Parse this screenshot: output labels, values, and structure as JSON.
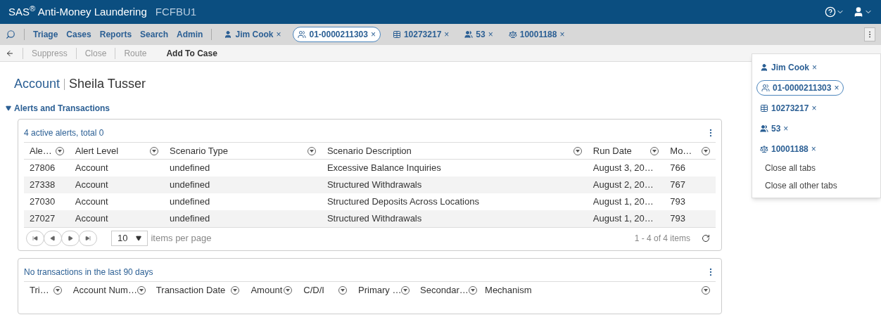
{
  "header": {
    "brand": "SAS",
    "brand_mark": "®",
    "product": "Anti-Money Laundering",
    "instance": "FCFBU1"
  },
  "nav": {
    "items": [
      "Triage",
      "Cases",
      "Reports",
      "Search",
      "Admin"
    ]
  },
  "tabs": [
    {
      "kind": "person",
      "label": "Jim Cook",
      "close": "×",
      "selected": false
    },
    {
      "kind": "case",
      "label": "01-0000211303",
      "close": "×",
      "selected": true
    },
    {
      "kind": "table",
      "label": "10273217",
      "close": "×",
      "selected": false
    },
    {
      "kind": "group",
      "label": "53",
      "close": "×",
      "selected": false
    },
    {
      "kind": "scale",
      "label": "10001188",
      "close": "×",
      "selected": false
    }
  ],
  "actions": [
    {
      "label": "Suppress",
      "disabled": true
    },
    {
      "label": "Close",
      "disabled": true
    },
    {
      "label": "Route",
      "disabled": true
    },
    {
      "label": "Add To Case",
      "disabled": false
    }
  ],
  "page_title": {
    "entity": "Account",
    "name": "Sheila Tusser"
  },
  "section": {
    "title": "Alerts and Transactions",
    "expanded": true
  },
  "alerts": {
    "summary": "4 active alerts, total 0",
    "columns": [
      "Ale…",
      "Alert Level",
      "Scenario Type",
      "Scenario Description",
      "Run Date",
      "Mo…"
    ],
    "rows": [
      [
        "27806",
        "Account",
        "undefined",
        "Excessive Balance Inquiries",
        "August 3, 20…",
        "766"
      ],
      [
        "27338",
        "Account",
        "undefined",
        "Structured Withdrawals",
        "August 2, 20…",
        "767"
      ],
      [
        "27030",
        "Account",
        "undefined",
        "Structured Deposits Across Locations",
        "August 1, 20…",
        "793"
      ],
      [
        "27027",
        "Account",
        "undefined",
        "Structured Withdrawals",
        "August 1, 20…",
        "793"
      ]
    ],
    "page_size": "10",
    "page_size_label": "items per page",
    "range": "1 - 4 of 4 items"
  },
  "transactions": {
    "summary": "No transactions in the last 90 days",
    "columns": [
      "Tri…",
      "Account Num…",
      "Transaction Date",
      "Amount",
      "C/D/I",
      "Primary …",
      "Secondar…",
      "Mechanism"
    ]
  },
  "tab_menu": {
    "tabs": [
      {
        "kind": "person",
        "label": "Jim Cook",
        "close": "×",
        "selected": false
      },
      {
        "kind": "case",
        "label": "01-0000211303",
        "close": "×",
        "selected": true
      },
      {
        "kind": "table",
        "label": "10273217",
        "close": "×",
        "selected": false
      },
      {
        "kind": "group",
        "label": "53",
        "close": "×",
        "selected": false
      },
      {
        "kind": "scale",
        "label": "10001188",
        "close": "×",
        "selected": false
      }
    ],
    "commands": [
      "Close all tabs",
      "Close all other tabs"
    ]
  }
}
